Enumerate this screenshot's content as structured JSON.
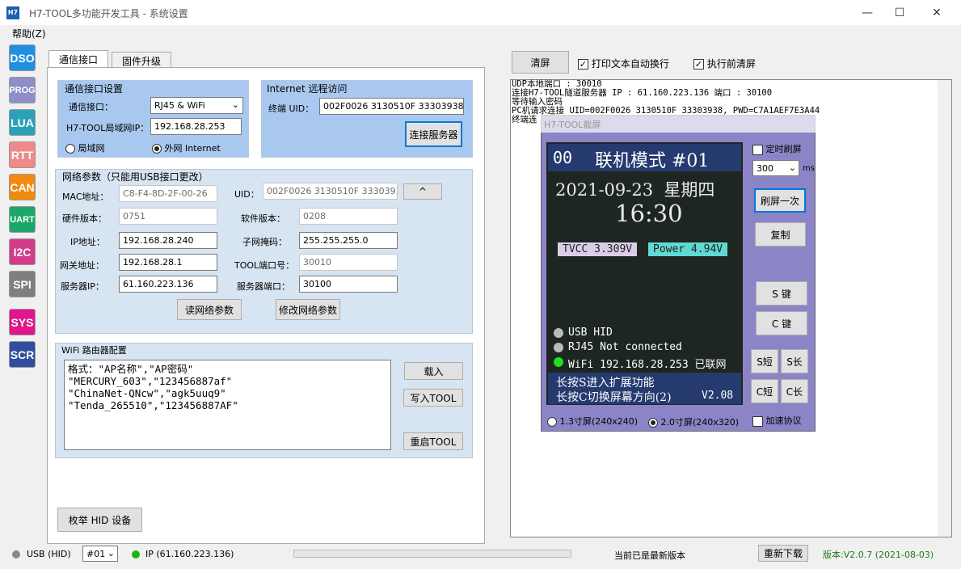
{
  "window": {
    "title": "H7-TOOL多功能开发工具 - 系统设置",
    "app_icon": "H7",
    "min": "—",
    "max": "☐",
    "close": "✕"
  },
  "menu": {
    "help": "帮助(Z)"
  },
  "sidebar": {
    "items": [
      {
        "label": "DSO",
        "color": "#1f8fe0"
      },
      {
        "label": "PROG",
        "color": "#8e8ec8"
      },
      {
        "label": "LUA",
        "color": "#2aa1b8"
      },
      {
        "label": "RTT",
        "color": "#f08a8a"
      },
      {
        "label": "CAN",
        "color": "#f08a10"
      },
      {
        "label": "UART",
        "color": "#1aa86a"
      },
      {
        "label": "I2C",
        "color": "#d23c8a"
      },
      {
        "label": "SPI",
        "color": "#7f7f7f"
      },
      {
        "label": "SYS",
        "color": "#e0168c"
      },
      {
        "label": "SCR",
        "color": "#2f4e9e"
      }
    ]
  },
  "tabs": [
    "通信接口",
    "固件升级"
  ],
  "comm": {
    "title": "通信接口设置",
    "iface_label": "通信接口：",
    "iface_value": "RJ45 & WiFi",
    "ip_label": "H7-TOOL局域网IP：",
    "ip_value": "192.168.28.253",
    "radio_lan": "局域网",
    "radio_wan": "外网 Internet"
  },
  "remote": {
    "title": "Internet 远程访问",
    "uid_label": "终端 UID：",
    "uid_value": "002F0026 3130510F 33303938",
    "connect_btn": "连接服务器"
  },
  "net": {
    "title": "网络参数（只能用USB接口更改）",
    "mac_label": "MAC地址：",
    "mac": "C8-F4-8D-2F-00-26",
    "uid_label": "UID：",
    "uid": "002F0026 3130510F 33303938",
    "expand": "^",
    "hw_label": "硬件版本：",
    "hw": "0751",
    "sw_label": "软件版本：",
    "sw": "0208",
    "ip_label": "IP地址：",
    "ip": "192.168.28.240",
    "mask_label": "子网掩码：",
    "mask": "255.255.255.0",
    "gw_label": "网关地址：",
    "gw": "192.168.28.1",
    "port_label": "TOOL端口号：",
    "port": "30010",
    "srv_label": "服务器IP：",
    "srv": "61.160.223.136",
    "srvport_label": "服务器端口：",
    "srvport": "30100",
    "read_btn": "读网络参数",
    "write_btn": "修改网络参数"
  },
  "wifi": {
    "title": "WiFi 路由器配置",
    "text": "格式：\"AP名称\",\"AP密码\"\n\"MERCURY_603\",\"123456887af\"\n\"ChinaNet-QNcw\",\"agk5uuq9\"\n\"Tenda_265510\",\"123456887AF\"",
    "load_btn": "载入",
    "write_btn": "写入TOOL",
    "restart_btn": "重启TOOL"
  },
  "enum_btn": "枚举 HID 设备",
  "log": {
    "clear_btn": "清屏",
    "opt_wrap": "打印文本自动换行",
    "opt_clear": "执行前清屏",
    "lines": "UDP本地端口 : 30010\n连接H7-TOOL隧道服务器 IP : 61.160.223.136 端口 : 30100\n等待输入密码\nPC机请求连接 UID=002F0026 3130510F 33303938, PWD=C7A1AEF7E3A44\n终端连"
  },
  "screen": {
    "title": "H7-TOOL截屏",
    "l1a": "00",
    "l1b": "联机模式 #01",
    "date": "2021-09-23  星期四",
    "time": "16:30",
    "tvcc": "TVCC 3.309V",
    "power": "Power 4.94V",
    "usb": "USB HID",
    "rj45": "RJ45 Not connected",
    "wifi": "WiFi 192.168.28.253 已联网",
    "hint1": "长按S进入扩展功能",
    "hint2": "长按C切换屏幕方向(2)",
    "ver": "V2.08",
    "timer": "定时刷屏",
    "interval": "300",
    "ms": "ms",
    "refresh": "刷屏一次",
    "copy": "复制",
    "skey": "S 键",
    "ckey": "C 键",
    "s_short": "S短",
    "s_long": "S长",
    "c_short": "C短",
    "c_long": "C长",
    "size1": "1.3寸屏(240x240)",
    "size2": "2.0寸屏(240x320)",
    "accel": "加速协议"
  },
  "status": {
    "usb": "USB (HID)",
    "dev": "#01",
    "ip": "IP (61.160.223.136)",
    "msg": "当前已是最新版本",
    "download": "重新下载",
    "version": "版本:V2.0.7 (2021-08-03)"
  }
}
